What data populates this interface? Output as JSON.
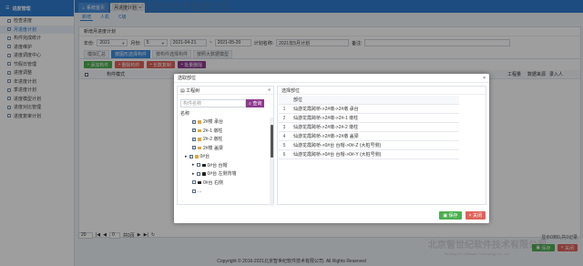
{
  "sidebar": {
    "title": "进度管理",
    "items": [
      {
        "label": "检查进度"
      },
      {
        "label": "月进度计划",
        "active": true
      },
      {
        "label": "构件完成统计"
      },
      {
        "label": "进度维护"
      },
      {
        "label": "进度调度中心"
      },
      {
        "label": "节假日管理"
      },
      {
        "label": "进度调整"
      },
      {
        "label": "年进度计划"
      },
      {
        "label": "季进度计划"
      },
      {
        "label": "进度模型计划"
      },
      {
        "label": "进度对比管理"
      },
      {
        "label": "进度复审计划"
      }
    ]
  },
  "topbar": {
    "tabs": [
      {
        "label": "系统首页"
      },
      {
        "label": "月进度计划",
        "active": true
      }
    ]
  },
  "subtabs": [
    "新增",
    "人机",
    "C级"
  ],
  "panel": {
    "title": "新增月进度计划",
    "filters": {
      "year_label": "年份:",
      "year": "2021",
      "month_label": "月份:",
      "month": "5",
      "date_from": "2021-04-21",
      "date_to": "2021-05-20",
      "plan_label": "计划名称:",
      "plan": "2021年5月计划",
      "note_label": "备注:"
    },
    "tabs": [
      "模拟汇总",
      "按图形选择构件",
      "按构件选择构件",
      "按照大数据模型"
    ],
    "toolbar": [
      {
        "label": "添加构件",
        "color": "#4caf50"
      },
      {
        "label": "删除构件",
        "color": "#e0625a"
      },
      {
        "label": "长数复制",
        "color": "#e0625a"
      },
      {
        "label": "批量删除",
        "color": "#8f3a8f"
      }
    ],
    "headers": {
      "left": "构件模式",
      "right1": "工程量",
      "right2": "数据来源",
      "right3": "录入人"
    },
    "pager": {
      "size": "20",
      "page": "0",
      "total": "共0页"
    },
    "page_stat": "显示0到0,共0记录"
  },
  "bottom_buttons": [
    {
      "label": "保存",
      "color": "#4caf50"
    },
    {
      "label": "关闭",
      "color": "#e0625a"
    }
  ],
  "modal": {
    "title": "选取部位",
    "left_title": "工程树",
    "collapse": "«",
    "search_placeholder": "构件名称",
    "search_button": "查询",
    "group_label": "名称",
    "tree": [
      {
        "label": "2#楼 承台",
        "indent": 36,
        "checked": true,
        "folder": true
      },
      {
        "label": "2#-1 墩柱",
        "indent": 36,
        "checked": true,
        "folder": true
      },
      {
        "label": "2#-2 墩柱",
        "indent": 36,
        "checked": true,
        "folder": true
      },
      {
        "label": "2#楼 盖梁",
        "indent": 36,
        "checked": true,
        "folder": true
      },
      {
        "label": "0#台",
        "indent": 28,
        "checked": true,
        "folder": true,
        "expand": true
      },
      {
        "label": "0#台 台帽",
        "indent": 36,
        "checked": false,
        "folder": true,
        "dark": true,
        "expand": true
      },
      {
        "label": "0#台 左侧背墙",
        "indent": 36,
        "checked": false,
        "folder": true,
        "dark": true,
        "expand": true
      },
      {
        "label": "0#台 右侧",
        "indent": 36,
        "checked": false,
        "folder": true,
        "dark": true
      },
      {
        "label": "...",
        "indent": 36,
        "checked": false,
        "folder": false
      }
    ],
    "right_title": "选择部位",
    "grid_header": "部位",
    "rows": [
      "仙游龙霞跨桥->2#墩->2#墩 承台",
      "仙游龙霞跨桥->2#墩->2#-1 墩柱",
      "仙游龙霞跨桥->2#墩->2#-2 墩柱",
      "仙游龙霞跨桥->2#墩->2#墩 盖梁",
      "仙游龙霞跨桥->0#台 台帽->0#-Z (大桩号侧)",
      "仙游龙霞跨桥->0#台 台帽->0#-Y (大桩号侧)"
    ],
    "buttons": [
      {
        "label": "保存",
        "color": "#4caf50"
      },
      {
        "label": "关闭",
        "color": "#e0625a"
      }
    ]
  },
  "watermark": {
    "cn": "北京智世纪软件技术有限公司",
    "en": "BeiJing KSJ Software Technology Co., Ltd"
  },
  "footer": "Copyright © 2016-2021北京智世纪软件技术有限公司. All Rights Reserved"
}
